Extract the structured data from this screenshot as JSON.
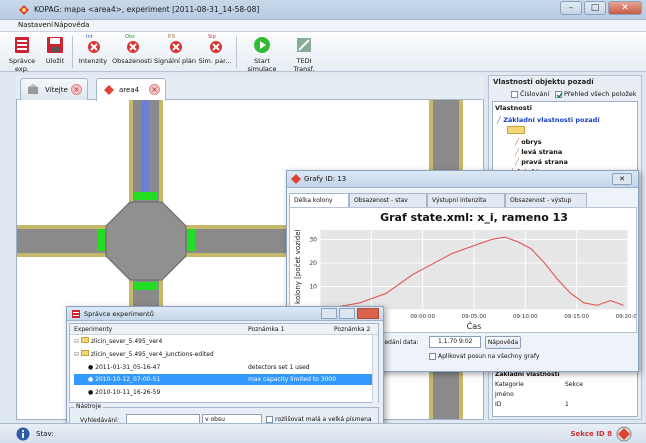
{
  "window": {
    "title": "KOPAG: mapa <area4>, experiment [2011-08-31_14-58-08]",
    "minimize": "–",
    "maximize": "□",
    "close": "✕"
  },
  "menu": {
    "items": [
      "Nastavení",
      "Nápověda"
    ]
  },
  "toolbar": {
    "buttons": [
      {
        "label": "Správce exp.",
        "small": ""
      },
      {
        "label": "Uložit",
        "small": ""
      },
      {
        "label": "Intenzity",
        "small": "Int"
      },
      {
        "label": "Obsazenosti",
        "small": "Obs"
      },
      {
        "label": "Signální plán",
        "small": "P.S"
      },
      {
        "label": "Sim. par...",
        "small": "Sip"
      },
      {
        "label": "Start simulace",
        "small": ""
      },
      {
        "label": "TEDI Transf.",
        "small": ""
      }
    ]
  },
  "tabs": [
    {
      "label": "Vítejte"
    },
    {
      "label": "area4"
    }
  ],
  "right_panel": {
    "title": "Vlastnosti objektu pozadí",
    "cislovani": "Číslování",
    "prehled": "Přehled všech položek",
    "vlastnosti": "Vlastnosti",
    "tree": [
      "Základní vlastnosti pozadí",
      "obrys",
      "levá strana",
      "pravá strana",
      "detektory"
    ],
    "basic_title": "Základní vlastnosti",
    "table": [
      {
        "key": "Kategorie",
        "value": "Sekce"
      },
      {
        "key": "Jméno",
        "value": ""
      },
      {
        "key": "ID",
        "value": "1"
      }
    ]
  },
  "graph": {
    "window_title": "Grafy ID: 13",
    "tabs": [
      "Délka kolony",
      "Obsazenost - stav",
      "Výstupní intenzita",
      "Obsazenost - výstup"
    ],
    "close": "✕",
    "search_label": "hledání data:",
    "search_value": "1.1.70 9:02",
    "help_button": "Nápověda",
    "apply_label": "Aplikovat posun na všechny grafy"
  },
  "chart_data": {
    "type": "line",
    "title": "Graf state.xml: x_i, rameno 13",
    "xlabel": "Čas",
    "ylabel": "a kolony [počet vozidel",
    "x_ticks": [
      "08:50:00",
      "08:55:00",
      "09:00:00",
      "09:05:00",
      "09:10:00",
      "09:15:00",
      "09:20:00"
    ],
    "y_ticks": [
      0,
      10,
      20,
      30
    ],
    "ylim": [
      0,
      34
    ],
    "xlim": [
      0,
      35
    ],
    "series": [
      {
        "color": "#e06060",
        "x": [
          0,
          1.5,
          3,
          4.5,
          6,
          7.5,
          9,
          10.5,
          12,
          13.5,
          15,
          16.5,
          18,
          19.5,
          21,
          22.5,
          24,
          25.5,
          27,
          28.5,
          30,
          31.5,
          33,
          34.5
        ],
        "values": [
          1,
          1,
          2,
          3,
          5,
          7,
          11,
          15,
          18,
          21,
          24,
          26,
          28,
          30,
          31,
          29,
          26,
          20,
          13,
          7,
          3,
          2,
          4,
          2
        ]
      }
    ]
  },
  "manager": {
    "title": "Správce experimentů",
    "columns": [
      "Experimenty",
      "Poznámka 1",
      "Poznámka 2"
    ],
    "rows": [
      {
        "name": "zlicin_sever_5.495_ver4",
        "note": "",
        "level": 0,
        "type": "folder"
      },
      {
        "name": "zlicin_sever_5.495_ver4_junctions-edited",
        "note": "",
        "level": 0,
        "type": "folder"
      },
      {
        "name": "2011-01-31_05-16-47",
        "note": "detectors set 1 used",
        "level": 1,
        "type": "item"
      },
      {
        "name": "2010-10-12_07-00-51",
        "note": "max capacity limited to 3000",
        "level": 1,
        "type": "item"
      },
      {
        "name": "2010-10-11_16-26-59",
        "note": "",
        "level": 1,
        "type": "item"
      }
    ],
    "tools_label": "Nástroje",
    "search_label": "Vyhledávání:",
    "dropdown": "v obsu poznámkách",
    "case_label": "rozlišovat malá a velká písmena"
  },
  "status": {
    "label": "Stav:",
    "right": "Sekce ID 8"
  },
  "colors": {
    "accent": "#3399ff",
    "road_lane_green": "#22dd22",
    "road_lane_blue": "#6d7ed9"
  }
}
